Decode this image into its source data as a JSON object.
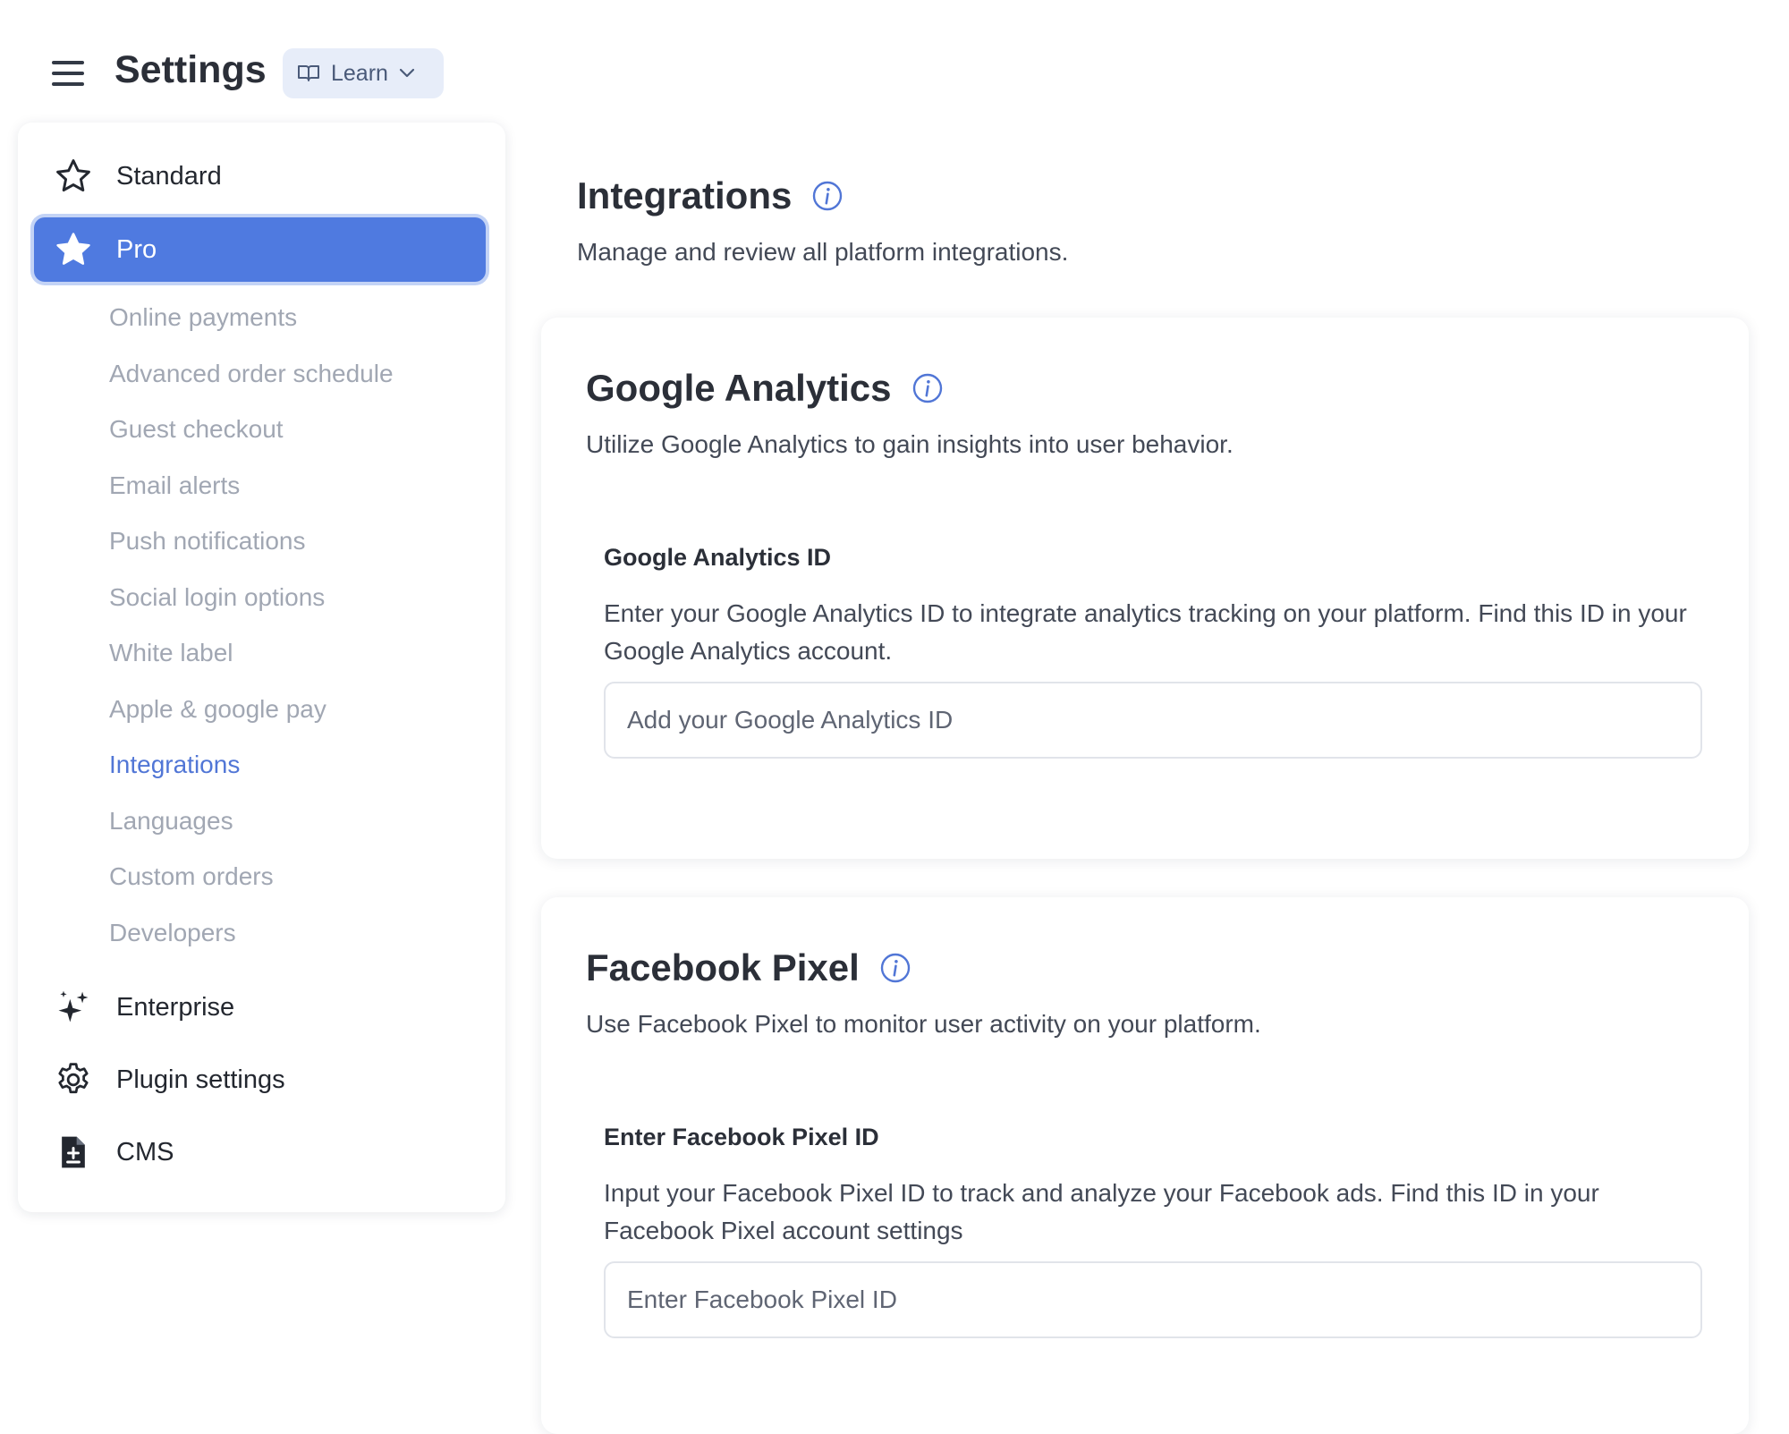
{
  "header": {
    "title": "Settings",
    "learn_label": "Learn"
  },
  "sidebar": {
    "plans": [
      {
        "label": "Standard",
        "icon": "star-outline-icon"
      },
      {
        "label": "Pro",
        "icon": "star-filled-icon",
        "active": true
      }
    ],
    "pro_items": [
      "Online payments",
      "Advanced order schedule",
      "Guest checkout",
      "Email alerts",
      "Push notifications",
      "Social login options",
      "White label",
      "Apple & google pay",
      "Integrations",
      "Languages",
      "Custom orders",
      "Developers"
    ],
    "active_sub_item": "Integrations",
    "bottom_items": [
      {
        "label": "Enterprise",
        "icon": "sparkles-icon"
      },
      {
        "label": "Plugin settings",
        "icon": "gear-icon"
      },
      {
        "label": "CMS",
        "icon": "document-icon"
      }
    ]
  },
  "main": {
    "title": "Integrations",
    "description": "Manage and review all platform integrations.",
    "cards": [
      {
        "title": "Google Analytics",
        "description": "Utilize Google Analytics to gain insights into user behavior.",
        "field_label": "Google Analytics ID",
        "field_help": "Enter your Google Analytics ID to integrate analytics tracking on your platform. Find this ID in your Google Analytics account.",
        "placeholder": "Add your Google Analytics ID",
        "value": ""
      },
      {
        "title": "Facebook Pixel",
        "description": "Use Facebook Pixel to monitor user activity on your platform.",
        "field_label": "Enter Facebook Pixel ID",
        "field_help": "Input your Facebook Pixel ID to track and analyze your Facebook ads. Find this ID in your Facebook Pixel account settings",
        "placeholder": "Enter Facebook Pixel ID",
        "value": ""
      }
    ]
  },
  "colors": {
    "accent": "#4f7ae0",
    "accent_ring": "#c3d3f6",
    "active_link": "#5176d6",
    "muted_text": "#a1a7b3",
    "learn_bg": "#e7edf9"
  }
}
